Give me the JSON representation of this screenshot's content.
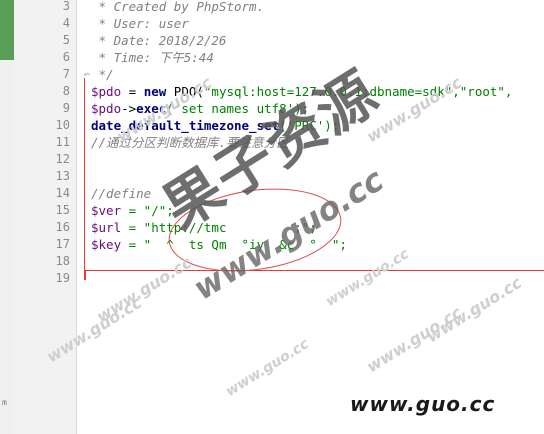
{
  "gutter": {
    "line_numbers": [
      "3",
      "4",
      "5",
      "6",
      "7",
      "8",
      "9",
      "10",
      "11",
      "12",
      "13",
      "14",
      "15",
      "16",
      "17",
      "18",
      "19"
    ]
  },
  "code": {
    "l3": " * Created by PhpStorm.",
    "l4": " * User: user",
    "l5": " * Date: 2018/2/26",
    "l6": " * Time: 下午5:44",
    "l7": " */",
    "l8_var": "$pdo",
    "l8_eq": " = ",
    "l8_new": "new",
    "l8_cls": " PDO(",
    "l8_str": "\"mysql:host=127.0.0.1;dbname=sdk\",\"root\",",
    "l9_var": "$pdo",
    "l9_arrow": "->",
    "l9_fn": "exec",
    "l9_rest": "('set names utf8');",
    "l10_fn": "date_default_timezone_set",
    "l10_rest": "('PRC');",
    "l11": "//通过分区判断数据库.要注意分区",
    "l12": "",
    "l13": "",
    "l14": "//define",
    "l15_var": "$ver",
    "l15_rest": " = \"/\";",
    "l16_var": "$url",
    "l16_rest": " = \"http://tmc         ;\";",
    "l17_var": "$key",
    "l17_rest": " = \"  ^  ts Qm  °iy  &c  °  \";",
    "l18": "",
    "l19": ""
  },
  "watermarks": {
    "big": "果子资源",
    "mid": "www.guo.cc",
    "bottom": "www.guo.cc",
    "repeated": [
      "www.guo.cc",
      "www.guo.cc",
      "www.guo.cc",
      "www.guo.cc",
      "www.guo.cc",
      "www.guo.cc",
      "www.guo.cc",
      "www.guo.cc"
    ]
  },
  "strip_label": "m"
}
